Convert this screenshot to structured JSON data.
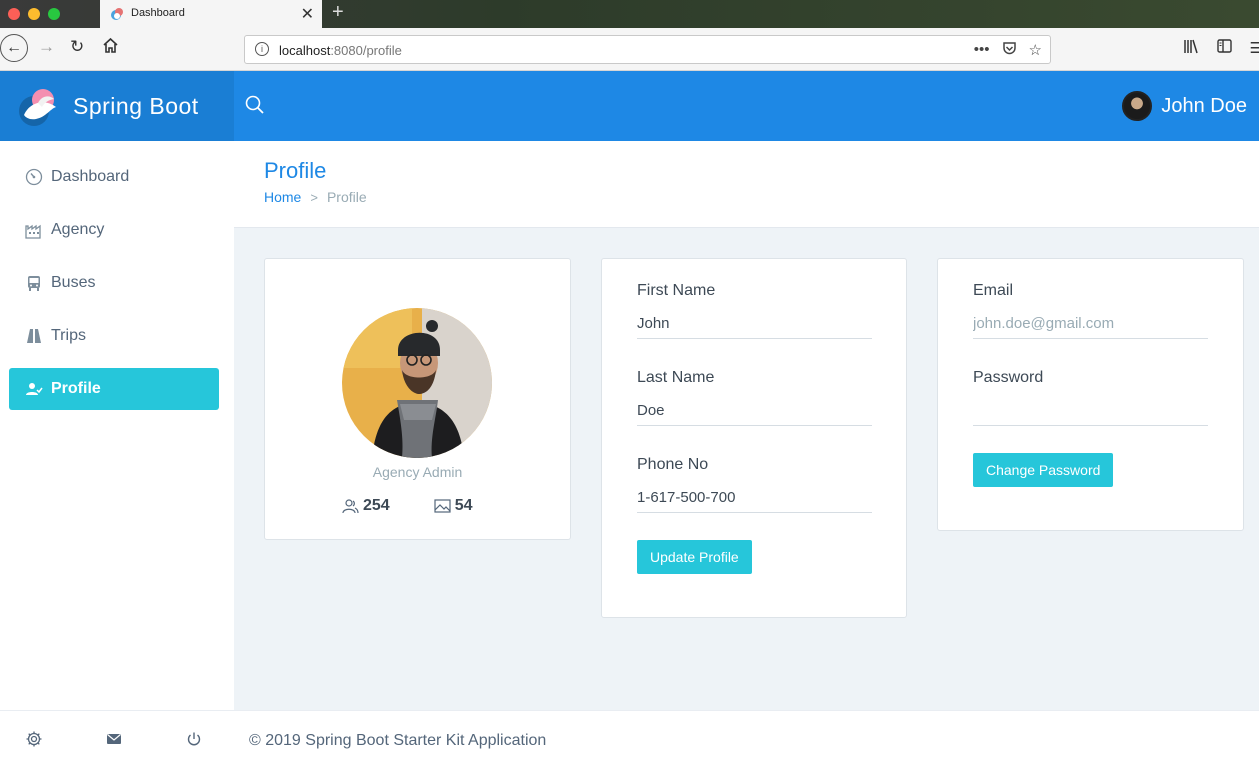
{
  "browser": {
    "tab_title": "Dashboard",
    "url_host": "localhost",
    "url_rest": ":8080/profile"
  },
  "header": {
    "brand": "Spring Boot",
    "user_name": "John Doe"
  },
  "sidebar": {
    "items": [
      {
        "label": "Dashboard",
        "icon": "speedometer-icon"
      },
      {
        "label": "Agency",
        "icon": "factory-icon"
      },
      {
        "label": "Buses",
        "icon": "bus-icon"
      },
      {
        "label": "Trips",
        "icon": "road-icon"
      },
      {
        "label": "Profile",
        "icon": "user-check-icon",
        "active": true
      }
    ],
    "footer_icons": [
      "gear-icon",
      "mail-icon",
      "power-icon"
    ]
  },
  "page": {
    "title": "Profile",
    "breadcrumb": {
      "home": "Home",
      "current": "Profile"
    }
  },
  "profile_card": {
    "role": "Agency Admin",
    "followers": "254",
    "photos": "54"
  },
  "details_form": {
    "first_name_label": "First Name",
    "first_name_value": "John",
    "last_name_label": "Last Name",
    "last_name_value": "Doe",
    "phone_label": "Phone No",
    "phone_value": "1-617-500-700",
    "submit_label": "Update Profile"
  },
  "account_form": {
    "email_label": "Email",
    "email_value": "john.doe@gmail.com",
    "password_label": "Password",
    "password_value": "",
    "submit_label": "Change Password"
  },
  "footer": {
    "text": "© 2019 Spring Boot Starter Kit Application"
  },
  "colors": {
    "primary": "#1e88e5",
    "accent": "#26c6da",
    "background": "#eef3f7"
  }
}
